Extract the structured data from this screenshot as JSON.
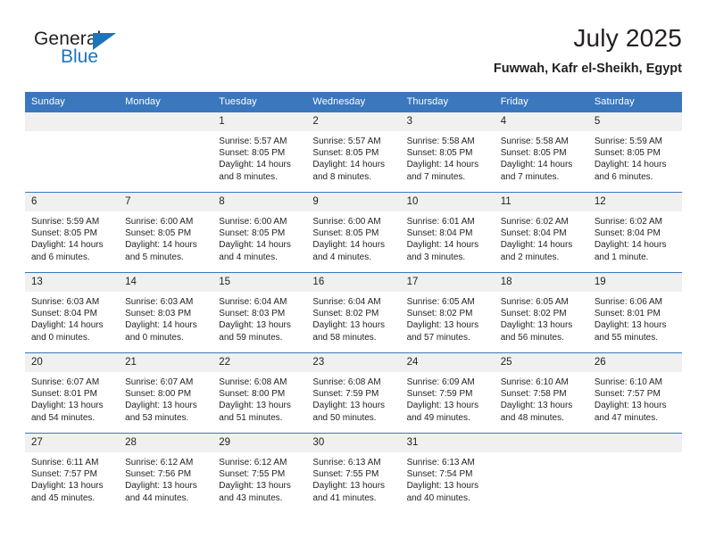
{
  "logo": {
    "word_one": "General",
    "word_two": "Blue",
    "accent_color": "#1e74bb"
  },
  "header": {
    "title": "July 2025",
    "subtitle": "Fuwwah, Kafr el-Sheikh, Egypt"
  },
  "theme": {
    "header_blue": "#3b77bd",
    "daynum_grey": "#f0f0f0",
    "text": "#231f20"
  },
  "weekday_headers": [
    "Sunday",
    "Monday",
    "Tuesday",
    "Wednesday",
    "Thursday",
    "Friday",
    "Saturday"
  ],
  "weeks": [
    [
      {
        "day": "",
        "details": ""
      },
      {
        "day": "",
        "details": ""
      },
      {
        "day": "1",
        "details": "Sunrise: 5:57 AM\nSunset: 8:05 PM\nDaylight: 14 hours\nand 8 minutes."
      },
      {
        "day": "2",
        "details": "Sunrise: 5:57 AM\nSunset: 8:05 PM\nDaylight: 14 hours\nand 8 minutes."
      },
      {
        "day": "3",
        "details": "Sunrise: 5:58 AM\nSunset: 8:05 PM\nDaylight: 14 hours\nand 7 minutes."
      },
      {
        "day": "4",
        "details": "Sunrise: 5:58 AM\nSunset: 8:05 PM\nDaylight: 14 hours\nand 7 minutes."
      },
      {
        "day": "5",
        "details": "Sunrise: 5:59 AM\nSunset: 8:05 PM\nDaylight: 14 hours\nand 6 minutes."
      }
    ],
    [
      {
        "day": "6",
        "details": "Sunrise: 5:59 AM\nSunset: 8:05 PM\nDaylight: 14 hours\nand 6 minutes."
      },
      {
        "day": "7",
        "details": "Sunrise: 6:00 AM\nSunset: 8:05 PM\nDaylight: 14 hours\nand 5 minutes."
      },
      {
        "day": "8",
        "details": "Sunrise: 6:00 AM\nSunset: 8:05 PM\nDaylight: 14 hours\nand 4 minutes."
      },
      {
        "day": "9",
        "details": "Sunrise: 6:00 AM\nSunset: 8:05 PM\nDaylight: 14 hours\nand 4 minutes."
      },
      {
        "day": "10",
        "details": "Sunrise: 6:01 AM\nSunset: 8:04 PM\nDaylight: 14 hours\nand 3 minutes."
      },
      {
        "day": "11",
        "details": "Sunrise: 6:02 AM\nSunset: 8:04 PM\nDaylight: 14 hours\nand 2 minutes."
      },
      {
        "day": "12",
        "details": "Sunrise: 6:02 AM\nSunset: 8:04 PM\nDaylight: 14 hours\nand 1 minute."
      }
    ],
    [
      {
        "day": "13",
        "details": "Sunrise: 6:03 AM\nSunset: 8:04 PM\nDaylight: 14 hours\nand 0 minutes."
      },
      {
        "day": "14",
        "details": "Sunrise: 6:03 AM\nSunset: 8:03 PM\nDaylight: 14 hours\nand 0 minutes."
      },
      {
        "day": "15",
        "details": "Sunrise: 6:04 AM\nSunset: 8:03 PM\nDaylight: 13 hours\nand 59 minutes."
      },
      {
        "day": "16",
        "details": "Sunrise: 6:04 AM\nSunset: 8:02 PM\nDaylight: 13 hours\nand 58 minutes."
      },
      {
        "day": "17",
        "details": "Sunrise: 6:05 AM\nSunset: 8:02 PM\nDaylight: 13 hours\nand 57 minutes."
      },
      {
        "day": "18",
        "details": "Sunrise: 6:05 AM\nSunset: 8:02 PM\nDaylight: 13 hours\nand 56 minutes."
      },
      {
        "day": "19",
        "details": "Sunrise: 6:06 AM\nSunset: 8:01 PM\nDaylight: 13 hours\nand 55 minutes."
      }
    ],
    [
      {
        "day": "20",
        "details": "Sunrise: 6:07 AM\nSunset: 8:01 PM\nDaylight: 13 hours\nand 54 minutes."
      },
      {
        "day": "21",
        "details": "Sunrise: 6:07 AM\nSunset: 8:00 PM\nDaylight: 13 hours\nand 53 minutes."
      },
      {
        "day": "22",
        "details": "Sunrise: 6:08 AM\nSunset: 8:00 PM\nDaylight: 13 hours\nand 51 minutes."
      },
      {
        "day": "23",
        "details": "Sunrise: 6:08 AM\nSunset: 7:59 PM\nDaylight: 13 hours\nand 50 minutes."
      },
      {
        "day": "24",
        "details": "Sunrise: 6:09 AM\nSunset: 7:59 PM\nDaylight: 13 hours\nand 49 minutes."
      },
      {
        "day": "25",
        "details": "Sunrise: 6:10 AM\nSunset: 7:58 PM\nDaylight: 13 hours\nand 48 minutes."
      },
      {
        "day": "26",
        "details": "Sunrise: 6:10 AM\nSunset: 7:57 PM\nDaylight: 13 hours\nand 47 minutes."
      }
    ],
    [
      {
        "day": "27",
        "details": "Sunrise: 6:11 AM\nSunset: 7:57 PM\nDaylight: 13 hours\nand 45 minutes."
      },
      {
        "day": "28",
        "details": "Sunrise: 6:12 AM\nSunset: 7:56 PM\nDaylight: 13 hours\nand 44 minutes."
      },
      {
        "day": "29",
        "details": "Sunrise: 6:12 AM\nSunset: 7:55 PM\nDaylight: 13 hours\nand 43 minutes."
      },
      {
        "day": "30",
        "details": "Sunrise: 6:13 AM\nSunset: 7:55 PM\nDaylight: 13 hours\nand 41 minutes."
      },
      {
        "day": "31",
        "details": "Sunrise: 6:13 AM\nSunset: 7:54 PM\nDaylight: 13 hours\nand 40 minutes."
      },
      {
        "day": "",
        "details": ""
      },
      {
        "day": "",
        "details": ""
      }
    ]
  ]
}
